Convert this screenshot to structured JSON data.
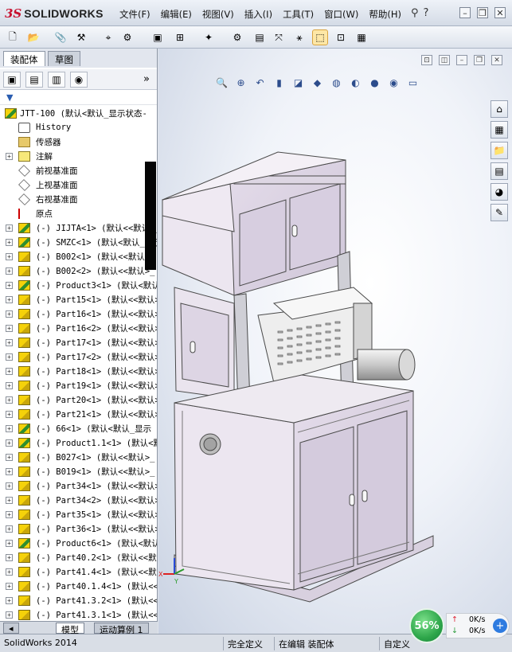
{
  "app": {
    "logo_ds": "3S",
    "logo_text": "SOLIDWORKS"
  },
  "menu": [
    "文件(F)",
    "编辑(E)",
    "视图(V)",
    "插入(I)",
    "工具(T)",
    "窗口(W)",
    "帮助(H)"
  ],
  "feature_manager": {
    "tabs": [
      "装配体",
      "草图"
    ],
    "top_node": "JTT-100  (默认<默认_显示状态-",
    "items": [
      {
        "label": "History",
        "icon": "history-icon",
        "expandable": false
      },
      {
        "label": "传感器",
        "icon": "sensor-folder-icon",
        "expandable": false
      },
      {
        "label": "注解",
        "icon": "annotation-icon",
        "expandable": true
      },
      {
        "label": "前视基准面",
        "icon": "plane-icon",
        "expandable": false
      },
      {
        "label": "上视基准面",
        "icon": "plane-icon",
        "expandable": false
      },
      {
        "label": "右视基准面",
        "icon": "plane-icon",
        "expandable": false
      },
      {
        "label": "原点",
        "icon": "origin-icon",
        "expandable": false
      },
      {
        "label": "(-) JIJTA<1> (默认<<默认>_",
        "icon": "assembly-icon",
        "expandable": true
      },
      {
        "label": "(-) SMZC<1> (默认<默认_显示",
        "icon": "assembly-icon",
        "expandable": true
      },
      {
        "label": "(-) B002<1> (默认<<默认>_",
        "icon": "part-icon",
        "expandable": true
      },
      {
        "label": "(-) B002<2> (默认<<默认>_",
        "icon": "part-icon",
        "expandable": true
      },
      {
        "label": "(-) Product3<1> (默认<默认_",
        "icon": "assembly-icon",
        "expandable": true
      },
      {
        "label": "(-) Part15<1> (默认<<默认>",
        "icon": "part-icon",
        "expandable": true
      },
      {
        "label": "(-) Part16<1> (默认<<默认>",
        "icon": "part-icon",
        "expandable": true
      },
      {
        "label": "(-) Part16<2> (默认<<默认>",
        "icon": "part-icon",
        "expandable": true
      },
      {
        "label": "(-) Part17<1> (默认<<默认>",
        "icon": "part-icon",
        "expandable": true
      },
      {
        "label": "(-) Part17<2> (默认<<默认>",
        "icon": "part-icon",
        "expandable": true
      },
      {
        "label": "(-) Part18<1> (默认<<默认>",
        "icon": "part-icon",
        "expandable": true
      },
      {
        "label": "(-) Part19<1> (默认<<默认>",
        "icon": "part-icon",
        "expandable": true
      },
      {
        "label": "(-) Part20<1> (默认<<默认>",
        "icon": "part-icon",
        "expandable": true
      },
      {
        "label": "(-) Part21<1> (默认<<默认>",
        "icon": "part-icon",
        "expandable": true
      },
      {
        "label": "(-) 66<1> (默认<默认_显示",
        "icon": "assembly-icon",
        "expandable": true
      },
      {
        "label": "(-) Product1.1<1> (默认<默",
        "icon": "assembly-icon",
        "expandable": true
      },
      {
        "label": "(-) B027<1> (默认<<默认>_",
        "icon": "part-icon",
        "expandable": true
      },
      {
        "label": "(-) B019<1> (默认<<默认>_",
        "icon": "part-icon",
        "expandable": true
      },
      {
        "label": "(-) Part34<1> (默认<<默认>",
        "icon": "part-icon",
        "expandable": true
      },
      {
        "label": "(-) Part34<2> (默认<<默认>",
        "icon": "part-icon",
        "expandable": true
      },
      {
        "label": "(-) Part35<1> (默认<<默认>",
        "icon": "part-icon",
        "expandable": true
      },
      {
        "label": "(-) Part36<1> (默认<<默认>",
        "icon": "part-icon",
        "expandable": true
      },
      {
        "label": "(-) Product6<1> (默认<默认_",
        "icon": "assembly-icon",
        "expandable": true
      },
      {
        "label": "(-) Part40.2<1> (默认<<默认",
        "icon": "part-icon",
        "expandable": true
      },
      {
        "label": "(-) Part41.4<1> (默认<<默认",
        "icon": "part-icon",
        "expandable": true
      },
      {
        "label": "(-) Part40.1.4<1> (默认<<",
        "icon": "part-icon",
        "expandable": true
      },
      {
        "label": "(-) Part41.3.2<1> (默认<<",
        "icon": "part-icon",
        "expandable": true
      },
      {
        "label": "(-) Part41.3.1<1> (默认<<",
        "icon": "part-icon",
        "expandable": true
      }
    ]
  },
  "bottom_tabs": [
    "模型",
    "运动算例 1"
  ],
  "status": {
    "app_version": "SolidWorks 2014",
    "definition": "完全定义",
    "editing": "在编辑 装配体",
    "units": "自定义"
  },
  "network": {
    "percent": "56%",
    "upload": "0K/s",
    "download": "0K/s"
  },
  "colors": {
    "accent": "#c8102e",
    "panel_fill": "#dcd4e3",
    "frame": "#5a5a5a"
  }
}
